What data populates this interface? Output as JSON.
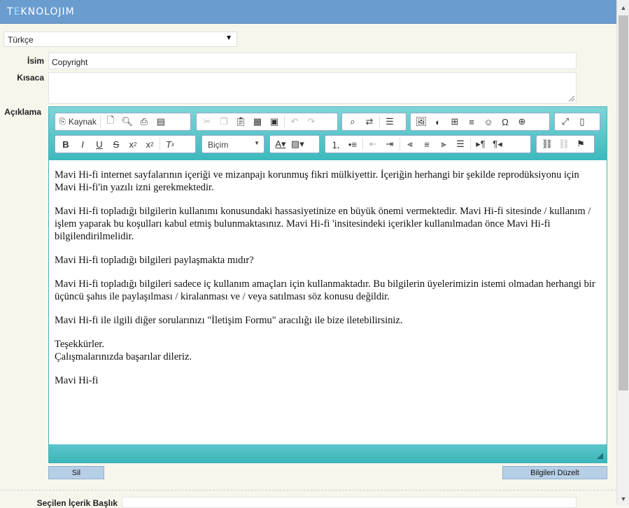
{
  "header": {
    "logo": "TEKNOLOJIM"
  },
  "language_select": {
    "value": "Türkçe"
  },
  "fields": {
    "name_label": "İsim",
    "name_value": "Copyright",
    "short_label": "Kısaca",
    "desc_label": "Açıklama"
  },
  "toolbar": {
    "source_label": "Kaynak",
    "format_label": "Biçim"
  },
  "content": {
    "paragraphs": [
      "Mavi Hi-fi internet sayfalarının içeriği ve mizanpajı korunmuş fikri mülkiyettir. İçeriğin herhangi bir şekilde reprodüksiyonu için Mavi Hi-fi'in yazılı izni gerekmektedir.",
      "Mavi Hi-fi topladığı bilgilerin kullanımı konusundaki hassasiyetinize en büyük önemi vermektedir. Mavi Hi-fi sitesinde / kullanım / işlem yaparak bu koşulları kabul etmiş bulunmaktasınız. Mavi Hi-fi 'insitesindeki içerikler kullanılmadan önce Mavi Hi-fi bilgilendirilmelidir.",
      "Mavi Hi-fi topladığı bilgileri paylaşmakta mıdır?",
      "Mavi Hi-fi topladığı bilgileri sadece iç kullanım amaçları için kullanmaktadır. Bu bilgilerin üyelerimizin istemi olmadan herhangi bir üçüncü şahıs ile paylaşılması / kiralanması ve / veya satılması söz konusu değildir.",
      "Mavi Hi-fi ile ilgili diğer sorularınızı \"İletişim Formu\" aracılığı ile bize iletebilirsiniz.",
      "Teşekkürler.",
      "Çalışmalarınızda başarılar dileriz.",
      "Mavi Hi-fi"
    ]
  },
  "buttons": {
    "delete": "Sil",
    "update": "Bilgileri Düzelt"
  },
  "bottom": {
    "selected_title_label": "Seçilen İçerik Başlık"
  }
}
